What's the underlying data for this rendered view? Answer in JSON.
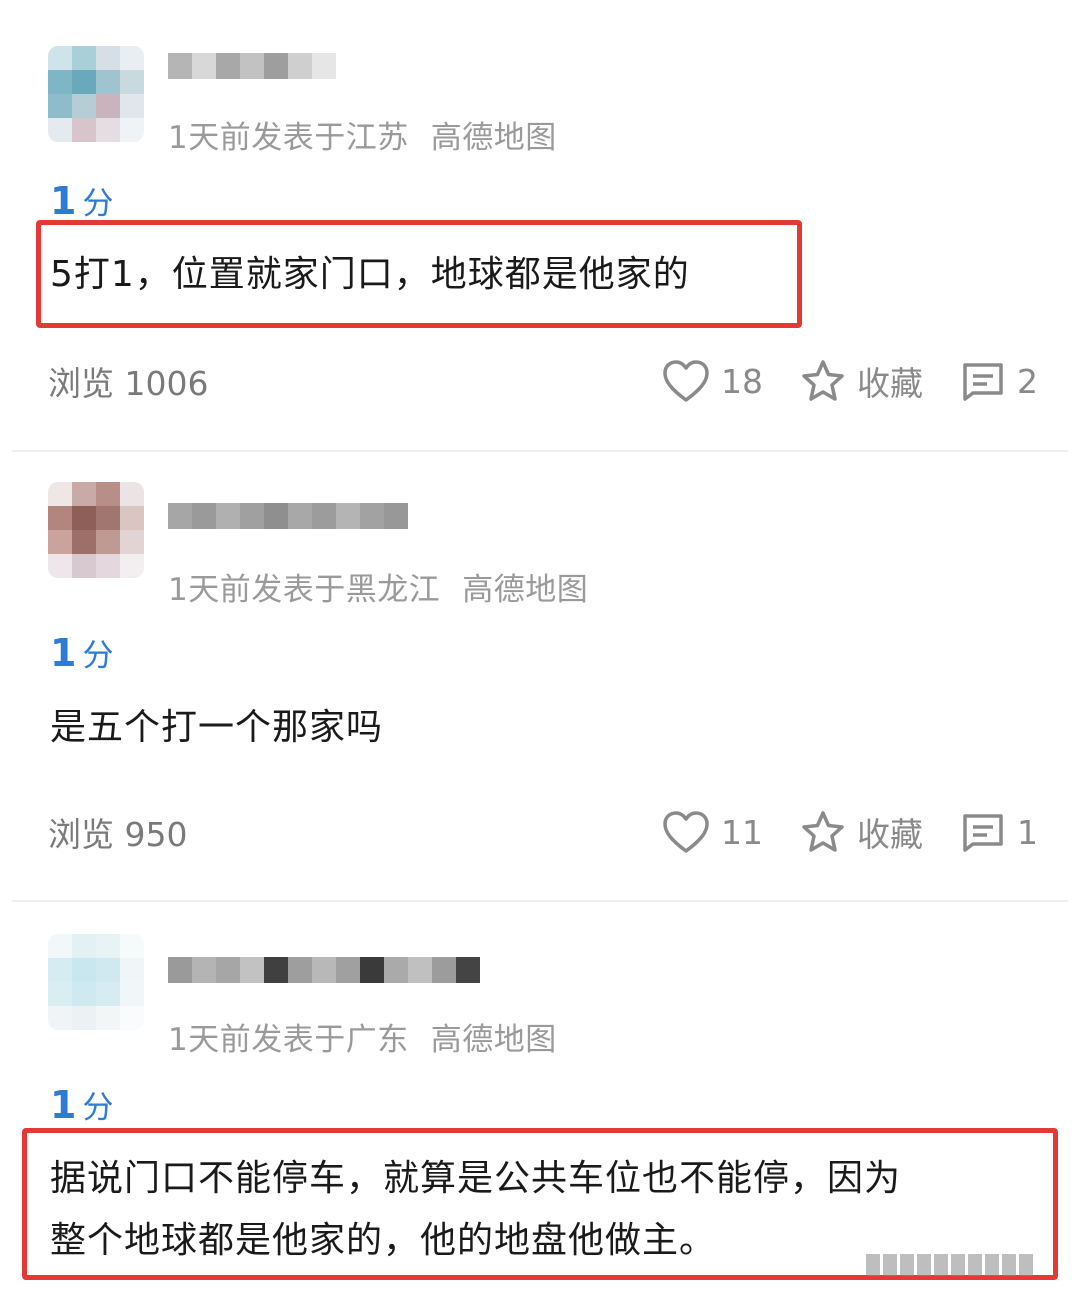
{
  "posts": [
    {
      "meta_time_location": "1天前发表于江苏",
      "meta_source": "高德地图",
      "score_value": "1",
      "score_unit": "分",
      "content": "5打1，位置就家门口，地球都是他家的",
      "views": "浏览 1006",
      "likes": "18",
      "favorite_label": "收藏",
      "comments": "2",
      "highlighted": true
    },
    {
      "meta_time_location": "1天前发表于黑龙江",
      "meta_source": "高德地图",
      "score_value": "1",
      "score_unit": "分",
      "content": "是五个打一个那家吗",
      "views": "浏览 950",
      "likes": "11",
      "favorite_label": "收藏",
      "comments": "1",
      "highlighted": false
    },
    {
      "meta_time_location": "1天前发表于广东",
      "meta_source": "高德地图",
      "score_value": "1",
      "score_unit": "分",
      "content_line1": "据说门口不能停车，就算是公共车位也不能停，因为",
      "content_line2": "整个地球都是他家的，他的地盘他做主。",
      "highlighted": true
    }
  ],
  "icons": {
    "like": "heart-icon",
    "favorite": "star-icon",
    "comment": "comment-icon"
  },
  "colors": {
    "score_blue": "#2e7bd6",
    "highlight_red": "#e53935",
    "meta_gray": "#9a9a9a"
  }
}
